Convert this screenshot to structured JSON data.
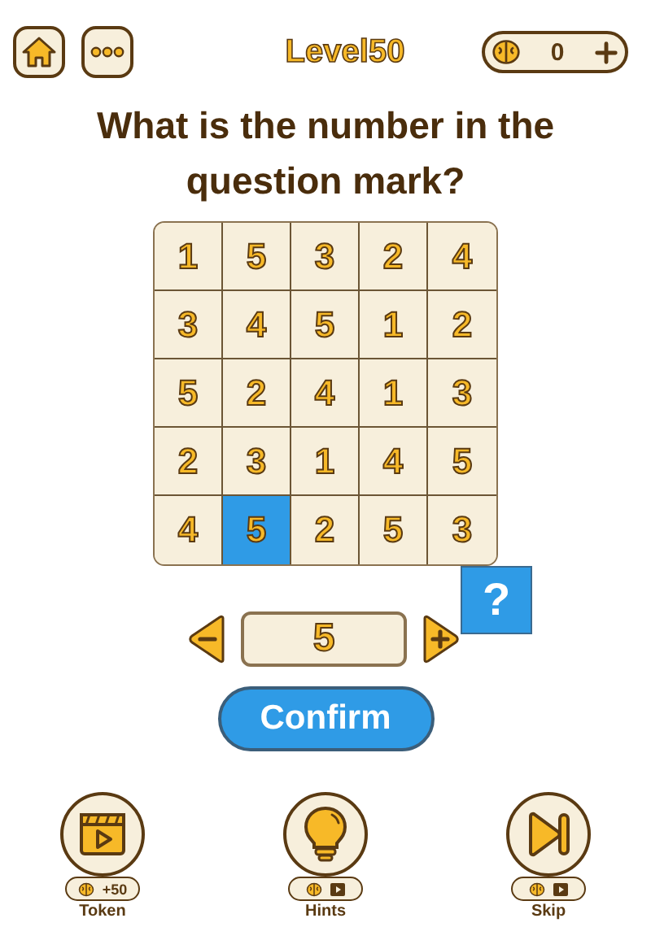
{
  "header": {
    "level": "Level50",
    "coins": "0"
  },
  "question": "What is the number in the question mark?",
  "grid": [
    [
      {
        "value": "1",
        "selected": false
      },
      {
        "value": "5",
        "selected": false
      },
      {
        "value": "3",
        "selected": false
      },
      {
        "value": "2",
        "selected": false
      },
      {
        "value": "4",
        "selected": false
      }
    ],
    [
      {
        "value": "3",
        "selected": false
      },
      {
        "value": "4",
        "selected": false
      },
      {
        "value": "5",
        "selected": false
      },
      {
        "value": "1",
        "selected": false
      },
      {
        "value": "2",
        "selected": false
      }
    ],
    [
      {
        "value": "5",
        "selected": false
      },
      {
        "value": "2",
        "selected": false
      },
      {
        "value": "4",
        "selected": false
      },
      {
        "value": "1",
        "selected": false
      },
      {
        "value": "3",
        "selected": false
      }
    ],
    [
      {
        "value": "2",
        "selected": false
      },
      {
        "value": "3",
        "selected": false
      },
      {
        "value": "1",
        "selected": false
      },
      {
        "value": "4",
        "selected": false
      },
      {
        "value": "5",
        "selected": false
      }
    ],
    [
      {
        "value": "4",
        "selected": false
      },
      {
        "value": "5",
        "selected": true
      },
      {
        "value": "2",
        "selected": false
      },
      {
        "value": "5",
        "selected": false
      },
      {
        "value": "3",
        "selected": false
      }
    ]
  ],
  "question_mark": "?",
  "answer": {
    "value": "5"
  },
  "confirm": "Confirm",
  "actions": [
    {
      "kind": "token",
      "label": "Token",
      "cost": "+50"
    },
    {
      "kind": "hints",
      "label": "Hints"
    },
    {
      "kind": "skip",
      "label": "Skip"
    }
  ]
}
